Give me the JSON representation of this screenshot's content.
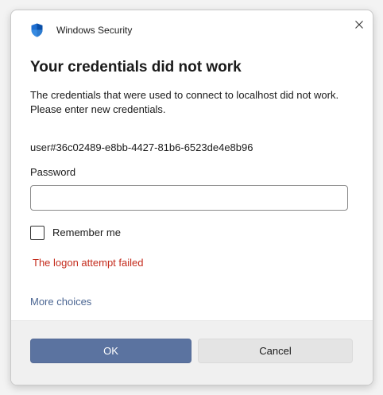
{
  "window": {
    "app_title": "Windows Security",
    "close_icon": "close-icon",
    "app_icon": "shield-icon"
  },
  "dialog": {
    "heading": "Your credentials did not work",
    "description": "The credentials that were used to connect to localhost did not work. Please enter new credentials.",
    "username": "user#36c02489-e8bb-4427-81b6-6523de4e8b96",
    "password_label": "Password",
    "password_value": "",
    "remember_label": "Remember me",
    "remember_checked": false,
    "error_message": "The logon attempt failed",
    "more_choices": "More choices"
  },
  "buttons": {
    "ok_label": "OK",
    "cancel_label": "Cancel"
  },
  "colors": {
    "primary_button": "#5b73a0",
    "error": "#c42b1c",
    "link": "#4a6592"
  }
}
